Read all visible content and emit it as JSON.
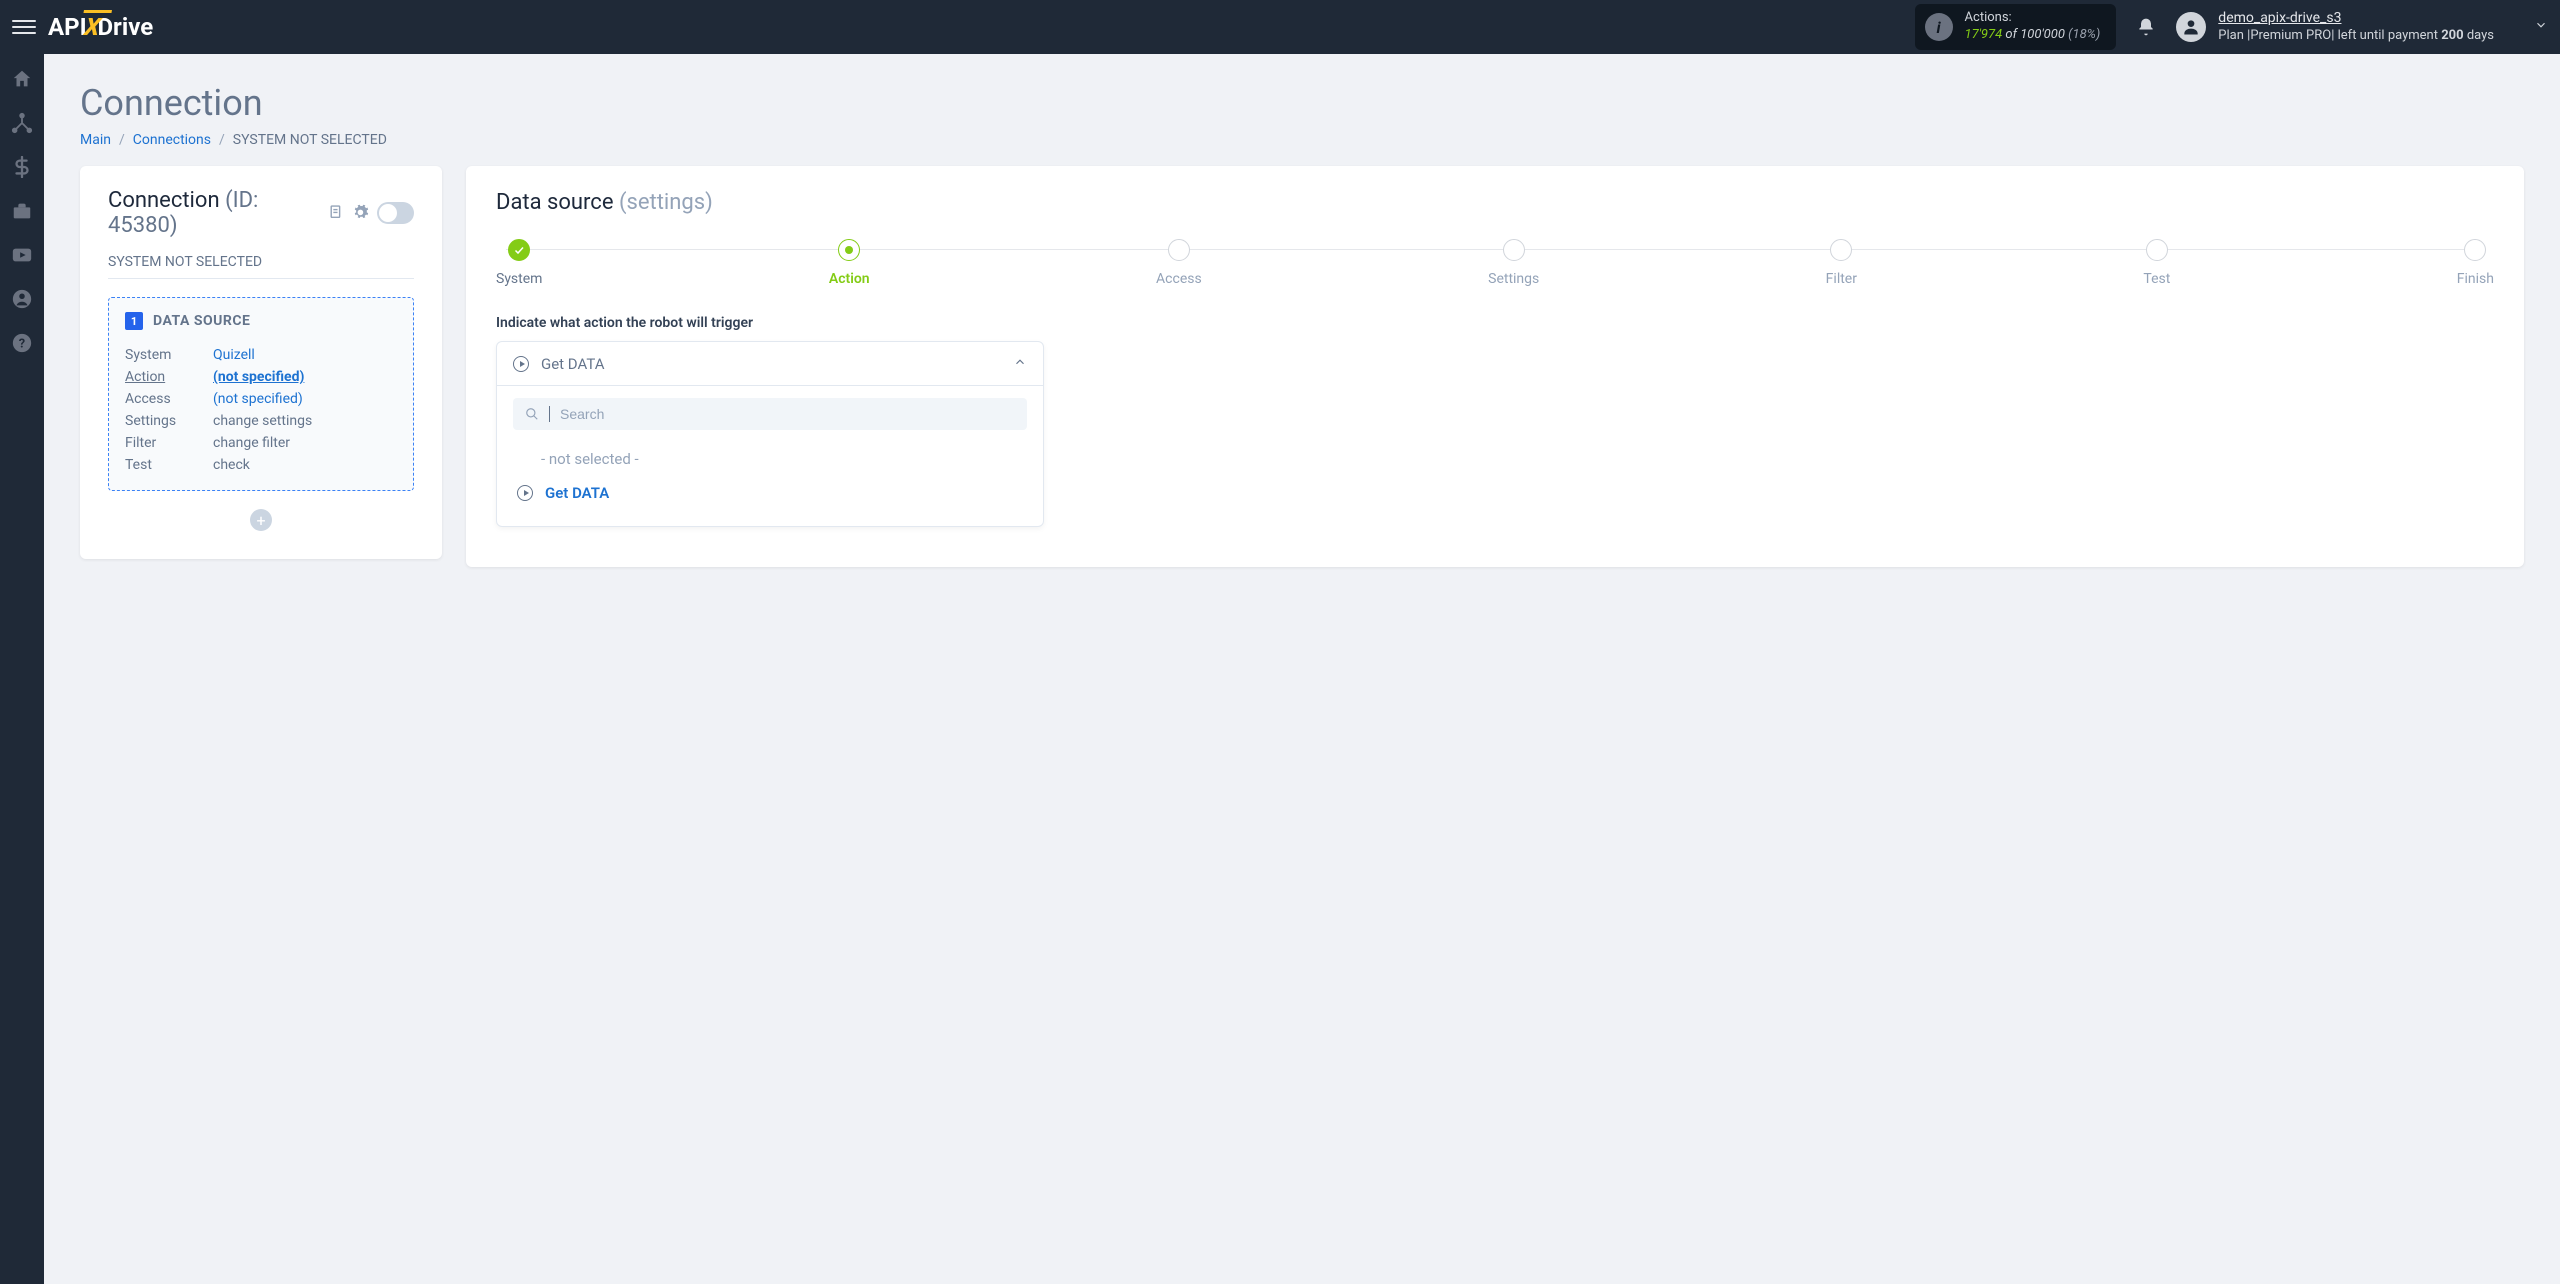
{
  "header": {
    "logo": {
      "api": "API",
      "x": "X",
      "drive": "Drive"
    },
    "actions": {
      "label": "Actions:",
      "count": "17'974",
      "of": "of",
      "total": "100'000",
      "pct": "(18%)"
    },
    "user": {
      "name": "demo_apix-drive_s3",
      "plan_prefix": "Plan |",
      "plan_name": "Premium PRO",
      "plan_sep": "|",
      "plan_text": " left until payment ",
      "plan_days": "200",
      "plan_days_suffix": " days"
    }
  },
  "page": {
    "title": "Connection",
    "breadcrumb": {
      "main": "Main",
      "connections": "Connections",
      "current": "SYSTEM NOT SELECTED"
    }
  },
  "left_panel": {
    "title": "Connection",
    "id_label": "(ID: 45380)",
    "not_selected": "SYSTEM NOT SELECTED",
    "datasource": {
      "badge": "1",
      "title": "DATA SOURCE",
      "rows": {
        "system_label": "System",
        "system_value": "Quizell",
        "action_label": "Action",
        "action_value": "(not specified)",
        "access_label": "Access",
        "access_value": "(not specified)",
        "settings_label": "Settings",
        "settings_value": "change settings",
        "filter_label": "Filter",
        "filter_value": "change filter",
        "test_label": "Test",
        "test_value": "check"
      }
    }
  },
  "right_panel": {
    "title": "Data source",
    "subtitle": "(settings)",
    "steps": {
      "system": "System",
      "action": "Action",
      "access": "Access",
      "settings": "Settings",
      "filter": "Filter",
      "test": "Test",
      "finish": "Finish"
    },
    "instruction": "Indicate what action the robot will trigger",
    "dropdown": {
      "selected": "Get DATA",
      "search_placeholder": "Search",
      "not_selected": "- not selected -",
      "option1": "Get DATA"
    }
  }
}
